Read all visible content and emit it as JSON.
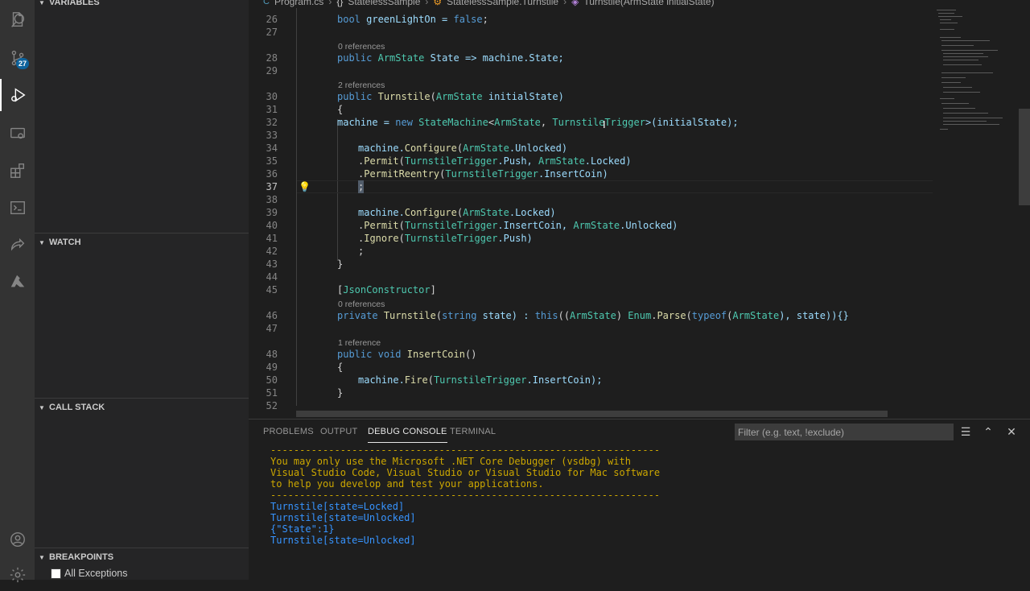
{
  "activity": {
    "scm_badge": "27"
  },
  "sidebar": {
    "variables": "VARIABLES",
    "watch": "WATCH",
    "call_stack": "CALL STACK",
    "breakpoints": "BREAKPOINTS",
    "bp_all_exceptions": "All Exceptions"
  },
  "breadcrumb": {
    "file": "Program.cs",
    "namespace": "StatelessSample",
    "class": "StatelessSample.Turnstile",
    "member": "Turnstile(ArmState initialState)"
  },
  "editor": {
    "ref0": "0 references",
    "ref2": "2 references",
    "ref0b": "0 references",
    "ref1": "1 reference",
    "lines": {
      "l26": "26",
      "l27": "27",
      "l28": "28",
      "l29": "29",
      "l30": "30",
      "l31": "31",
      "l32": "32",
      "l33": "33",
      "l34": "34",
      "l35": "35",
      "l36": "36",
      "l37": "37",
      "l38": "38",
      "l39": "39",
      "l40": "40",
      "l41": "41",
      "l42": "42",
      "l43": "43",
      "l44": "44",
      "l45": "45",
      "l46": "46",
      "l47": "47",
      "l48": "48",
      "l49": "49",
      "l50": "50",
      "l51": "51",
      "l52": "52"
    },
    "code": {
      "c26a": "bool",
      "c26b": " greenLightOn = ",
      "c26c": "false",
      "c26d": ";",
      "c28a": "public",
      "c28b": " ",
      "c28c": "ArmState",
      "c28d": " State => machine.State;",
      "c30a": "public",
      "c30b": " ",
      "c30c": "Turnstile",
      "c30d": "(",
      "c30e": "ArmState",
      "c30f": " initialState)",
      "c31": "{",
      "c32a": "machine = ",
      "c32b": "new",
      "c32c": " ",
      "c32d": "StateMachine",
      "c32e": "<",
      "c32f": "ArmState",
      "c32g": ", ",
      "c32h": "TurnstileTrigger",
      "c32i": ">(initialState);",
      "c34a": "machine.",
      "c34b": "Configure",
      "c34c": "(",
      "c34d": "ArmState",
      "c34e": ".Unlocked)",
      "c35a": ".",
      "c35b": "Permit",
      "c35c": "(",
      "c35d": "TurnstileTrigger",
      "c35e": ".Push, ",
      "c35f": "ArmState",
      "c35g": ".Locked)",
      "c36a": ".",
      "c36b": "PermitReentry",
      "c36c": "(",
      "c36d": "TurnstileTrigger",
      "c36e": ".InsertCoin)",
      "c37": ";",
      "c39a": "machine.",
      "c39b": "Configure",
      "c39c": "(",
      "c39d": "ArmState",
      "c39e": ".Locked)",
      "c40a": ".",
      "c40b": "Permit",
      "c40c": "(",
      "c40d": "TurnstileTrigger",
      "c40e": ".InsertCoin, ",
      "c40f": "ArmState",
      "c40g": ".Unlocked)",
      "c41a": ".",
      "c41b": "Ignore",
      "c41c": "(",
      "c41d": "TurnstileTrigger",
      "c41e": ".Push)",
      "c42": ";",
      "c43": "}",
      "c45a": "[",
      "c45b": "JsonConstructor",
      "c45c": "]",
      "c46a": "private",
      "c46b": " ",
      "c46c": "Turnstile",
      "c46d": "(",
      "c46e": "string",
      "c46f": " state) : ",
      "c46g": "this",
      "c46h": "((",
      "c46i": "ArmState",
      "c46j": ") ",
      "c46k": "Enum",
      "c46l": ".",
      "c46m": "Parse",
      "c46n": "(",
      "c46o": "typeof",
      "c46p": "(",
      "c46q": "ArmState",
      "c46r": "), state)){}",
      "c48a": "public",
      "c48b": " ",
      "c48c": "void",
      "c48d": " ",
      "c48e": "InsertCoin",
      "c48f": "()",
      "c49": "{",
      "c50a": "machine.",
      "c50b": "Fire",
      "c50c": "(",
      "c50d": "TurnstileTrigger",
      "c50e": ".InsertCoin);",
      "c51": "}"
    }
  },
  "panel": {
    "tabs": {
      "problems": "PROBLEMS",
      "output": "OUTPUT",
      "debug_console": "DEBUG CONSOLE",
      "terminal": "TERMINAL"
    },
    "filter_placeholder": "Filter (e.g. text, !exclude)",
    "console": {
      "dash1": "-------------------------------------------------------------------",
      "w1": "You may only use the Microsoft .NET Core Debugger (vsdbg) with",
      "w2": "Visual Studio Code, Visual Studio or Visual Studio for Mac software",
      "w3": "to help you develop and test your applications.",
      "dash2": "-------------------------------------------------------------------",
      "o1": "Turnstile[state=Locked]",
      "o2": "Turnstile[state=Unlocked]",
      "o3": "{\"State\":1}",
      "o4": "Turnstile[state=Unlocked]"
    }
  }
}
